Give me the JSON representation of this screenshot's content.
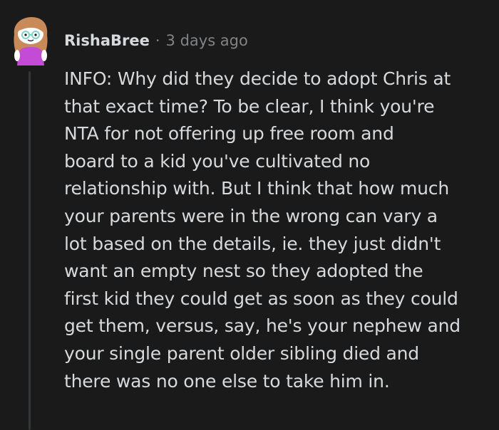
{
  "comment": {
    "username": "RishaBree",
    "separator": "·",
    "timestamp": "3 days ago",
    "avatar_icon": "snoo-avatar-icon",
    "body_lines": [
      "INFO: Why did they decide to adopt Chris at",
      "that exact time? To be clear, I think you're",
      "NTA for not offering up free room and",
      "board to a kid you've cultivated no",
      "relationship with. But I think that how much",
      "your parents were in the wrong can vary a",
      "lot based on the details, ie. they just didn't",
      "want an empty nest so they adopted the",
      "first kid they could get as soon as they could",
      "get them, versus, say, he's your nephew and",
      "your single parent older sibling died and",
      "there was no one else to take him in."
    ]
  },
  "colors": {
    "background": "#1a1a1b",
    "text": "#d7dadc",
    "meta": "#818384",
    "thread_line": "#343536",
    "avatar_hair": "#c98a5a",
    "avatar_shirt": "#c34bd6",
    "avatar_glasses": "#7fd3c8"
  }
}
